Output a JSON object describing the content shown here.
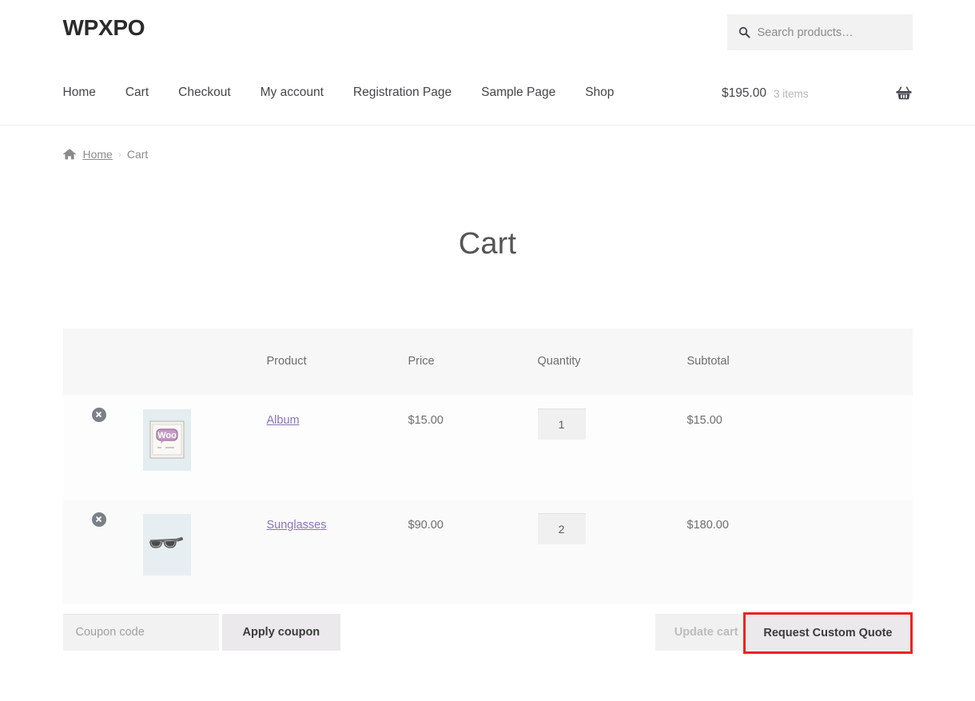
{
  "header": {
    "site_title": "WPXPO",
    "search": {
      "placeholder": "Search products…",
      "value": "",
      "icon": "search-icon"
    },
    "nav": [
      {
        "label": "Home"
      },
      {
        "label": "Cart"
      },
      {
        "label": "Checkout"
      },
      {
        "label": "My account"
      },
      {
        "label": "Registration Page"
      },
      {
        "label": "Sample Page"
      },
      {
        "label": "Shop"
      }
    ],
    "cart_summary": {
      "amount": "$195.00",
      "count": "3 items",
      "icon": "shopping-basket-icon"
    }
  },
  "breadcrumb": {
    "home_icon": "home-icon",
    "home_label": "Home",
    "separator": "›",
    "current": "Cart"
  },
  "page": {
    "title": "Cart"
  },
  "cart": {
    "columns": {
      "remove": "",
      "thumb": "",
      "product": "Product",
      "price": "Price",
      "quantity": "Quantity",
      "subtotal": "Subtotal"
    },
    "items": [
      {
        "remove_icon": "remove-item-icon",
        "thumb_icon": "album-woo-thumbnail",
        "name": "Album",
        "price": "$15.00",
        "quantity": "1",
        "subtotal": "$15.00"
      },
      {
        "remove_icon": "remove-item-icon",
        "thumb_icon": "sunglasses-thumbnail",
        "name": "Sunglasses",
        "price": "$90.00",
        "quantity": "2",
        "subtotal": "$180.00"
      }
    ]
  },
  "actions": {
    "coupon_placeholder": "Coupon code",
    "coupon_value": "",
    "apply_coupon": "Apply coupon",
    "update_cart": "Update cart",
    "request_quote": "Request Custom Quote"
  },
  "colors": {
    "highlight_border": "#ee2222",
    "product_link": "#8a74b8",
    "table_header_bg": "#f7f7f7",
    "button_bg": "#ebe9eb",
    "text": "#43454b",
    "muted_text": "#6d6d6d"
  }
}
